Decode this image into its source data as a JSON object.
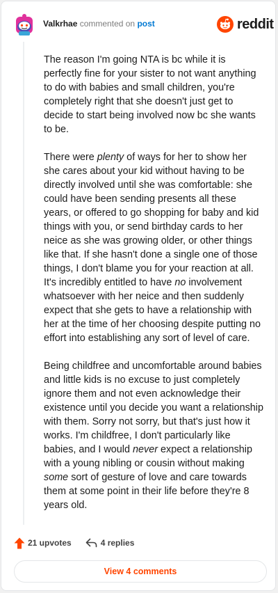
{
  "header": {
    "username": "Valkrhae",
    "action_text": "commented on",
    "post_link": "post",
    "logo_wordmark": "reddit"
  },
  "comment": {
    "paragraphs": [
      [
        {
          "text": "The reason I'm going NTA is bc while it is perfectly fine for your sister to not want anything to do with babies and small children, you're completely right that she doesn't just get to decide to start being involved now bc she wants to be.",
          "em": false
        }
      ],
      [
        {
          "text": "There were ",
          "em": false
        },
        {
          "text": "plenty",
          "em": true
        },
        {
          "text": " of ways for her to show her she cares about your kid without having to be directly involved until she was comfortable: she could have been sending presents all these years, or offered to go shopping for baby and kid things with you, or send birthday cards to her neice as she was growing older, or other things like that. If she hasn't done a single one of those things, I don't blame you for your reaction at all. It's incredibly entitled to have ",
          "em": false
        },
        {
          "text": "no",
          "em": true
        },
        {
          "text": " involvement whatsoever with her neice and then suddenly expect that she gets to have a relationship with her at the time of her choosing despite putting no effort into establishing any sort of level of care.",
          "em": false
        }
      ],
      [
        {
          "text": "Being childfree and uncomfortable around babies and little kids is no excuse to just completely ignore them and not even acknowledge their existence until you decide you want a relationship with them. Sorry not sorry, but that's just how it works. I'm childfree, I don't particularly like babies, and I would ",
          "em": false
        },
        {
          "text": "never",
          "em": true
        },
        {
          "text": " expect a relationship with a young nibling or cousin without making ",
          "em": false
        },
        {
          "text": "some",
          "em": true
        },
        {
          "text": " sort of gesture of love and care towards them at some point in their life before they're 8 years old.",
          "em": false
        }
      ]
    ]
  },
  "footer": {
    "upvotes_label": "21 upvotes",
    "replies_label": "4 replies",
    "view_comments_label": "View 4 comments"
  },
  "colors": {
    "accent": "#ff4500",
    "link": "#0079d3",
    "text": "#1c1c1c",
    "muted": "#7c7c7c"
  },
  "icons": {
    "avatar": "snoo-avatar-icon",
    "logo": "reddit-snoo-icon",
    "upvote": "upvote-arrow-icon",
    "reply": "reply-arrow-icon"
  }
}
